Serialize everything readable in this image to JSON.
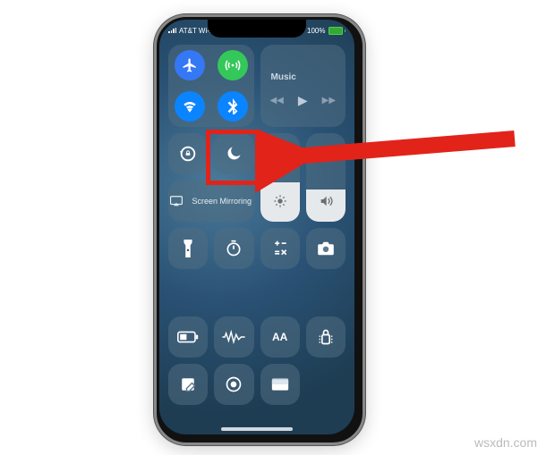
{
  "status_bar": {
    "carrier": "AT&T Wi-Fi",
    "battery_pct": "100%",
    "battery_symbol": "⚡"
  },
  "connectivity": {
    "airplane_label": "airplane-mode",
    "cellular_label": "cellular-data",
    "wifi_label": "wifi",
    "bluetooth_label": "bluetooth"
  },
  "music": {
    "title": "Music",
    "prev": "◀◀",
    "play": "▶",
    "next": "▶▶"
  },
  "tiles": {
    "rotation_lock": "rotation-lock",
    "dnd": "do-not-disturb",
    "screen_mirroring": "Screen Mirroring",
    "brightness": "brightness",
    "volume": "volume",
    "flashlight": "flashlight",
    "timer": "timer",
    "calculator": "calculator",
    "camera": "camera",
    "low_power": "low-power-mode",
    "voice_memo": "voice-memos",
    "text_size": "text-size",
    "text_size_glyph": "AA",
    "guided_access": "guided-access",
    "notes": "notes",
    "screen_record": "screen-recording",
    "wallet": "wallet"
  },
  "footer": {
    "watermark": "wsxdn.com"
  }
}
